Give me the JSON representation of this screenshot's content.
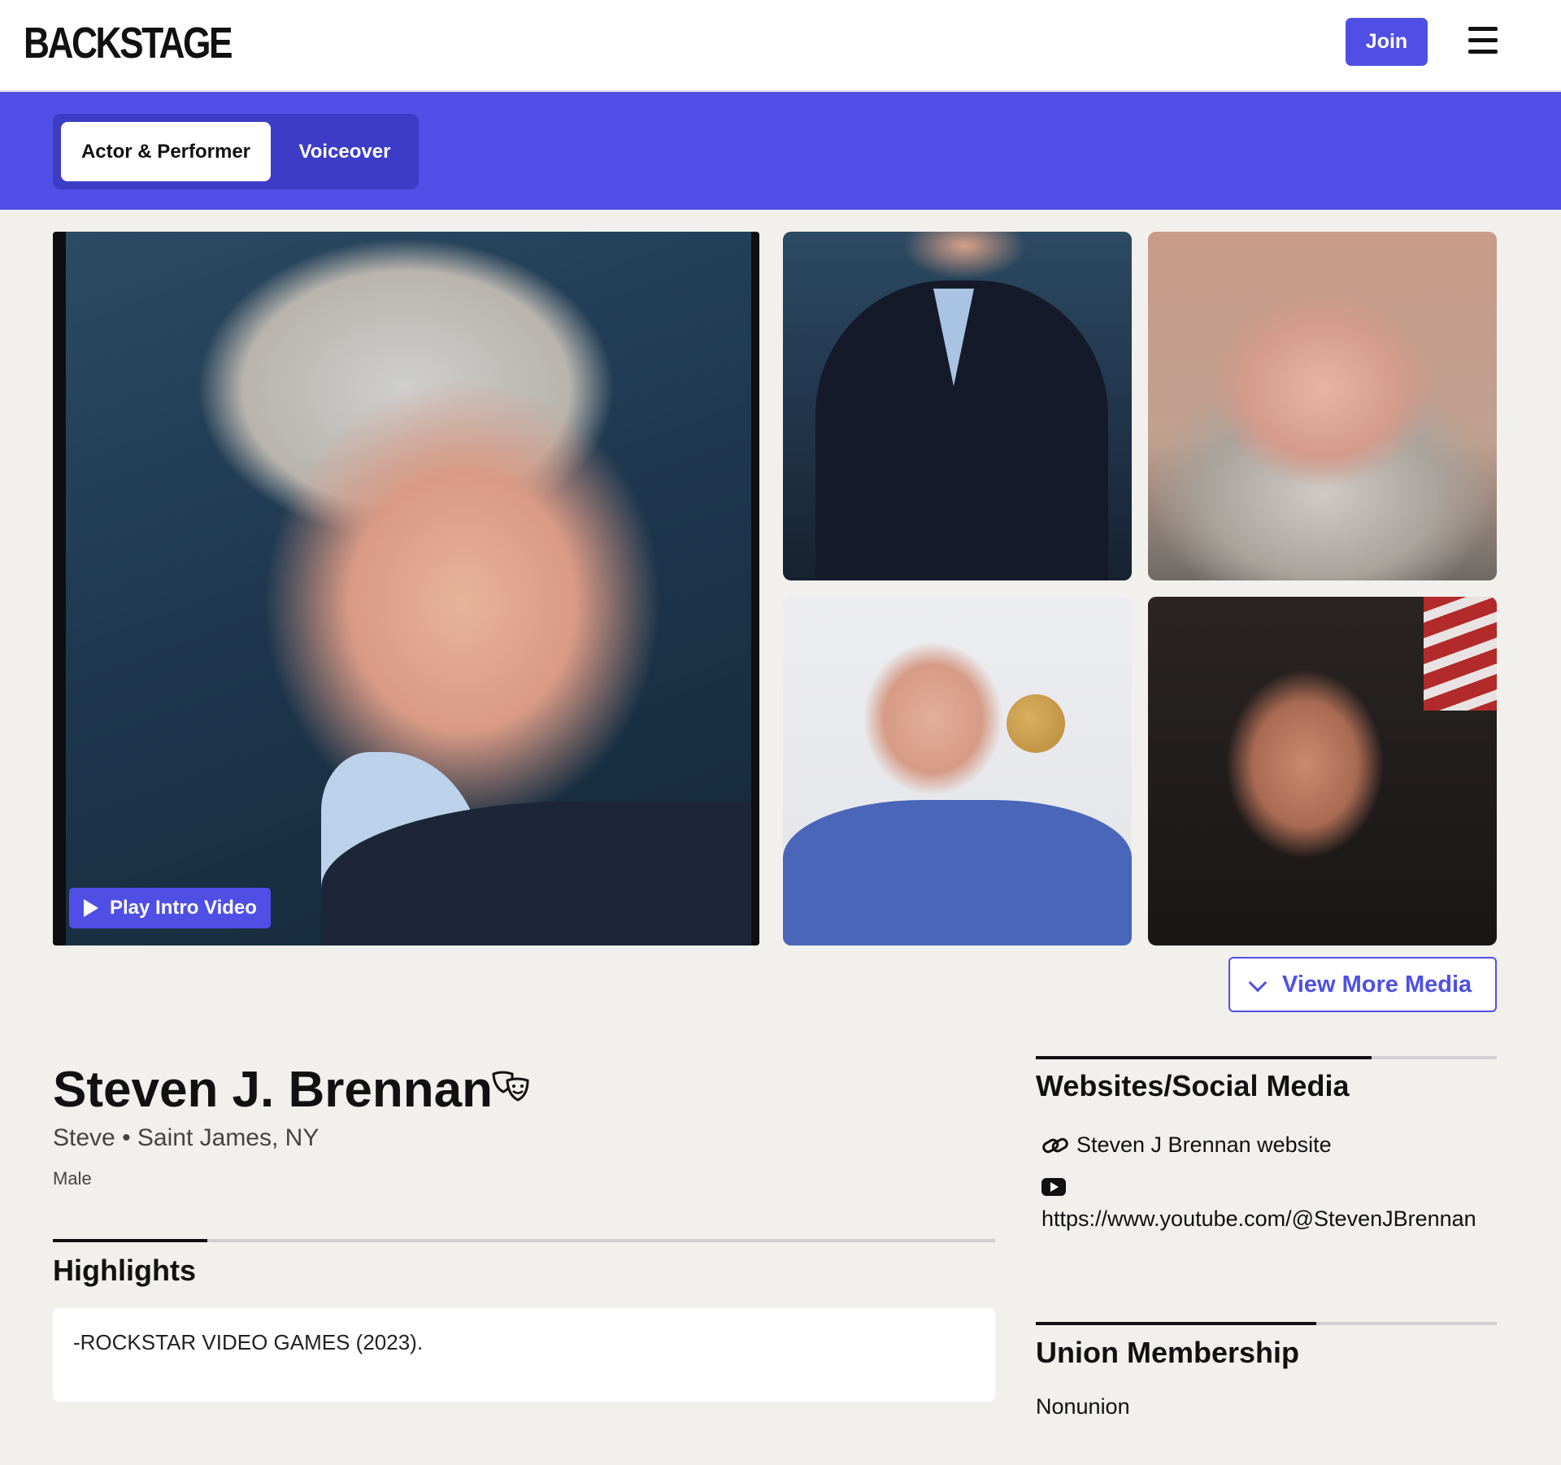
{
  "header": {
    "logo": "BACKSTAGE",
    "join_label": "Join",
    "menu_icon": "hamburger-menu-icon"
  },
  "tabs": [
    {
      "label": "Actor & Performer",
      "active": true
    },
    {
      "label": "Voiceover",
      "active": false
    }
  ],
  "media": {
    "play_intro_label": "Play Intro Video",
    "view_more_label": "View More Media"
  },
  "profile": {
    "name": "Steven J. Brennan",
    "nickname": "Steve",
    "separator": "•",
    "location": "Saint James, NY",
    "gender": "Male",
    "badge_icon": "theater-masks-icon"
  },
  "highlights": {
    "title": "Highlights",
    "text": "-ROCKSTAR VIDEO GAMES (2023)."
  },
  "websites": {
    "title": "Websites/Social Media",
    "items": [
      {
        "icon": "link-icon",
        "label": "Steven J Brennan website"
      },
      {
        "icon": "youtube-icon",
        "label": "https://www.youtube.com/@StevenJBrennan"
      }
    ]
  },
  "union": {
    "title": "Union Membership",
    "value": "Nonunion"
  },
  "colors": {
    "accent": "#5050e8",
    "band_dark": "#3c3cc6",
    "background": "#f1f0ed"
  }
}
